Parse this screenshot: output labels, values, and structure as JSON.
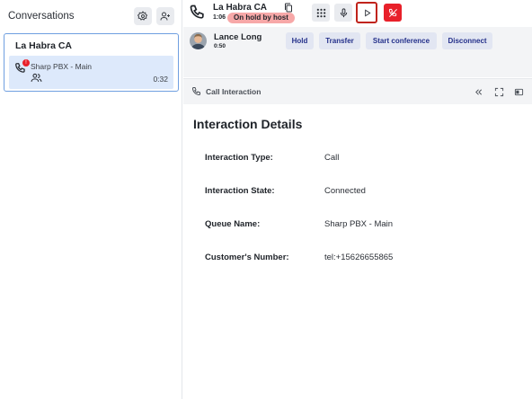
{
  "sidebar": {
    "title": "Conversations",
    "conversation": {
      "name": "La Habra CA",
      "queue": "Sharp PBX - Main",
      "duration": "0:32",
      "badge": "!"
    }
  },
  "callbar": {
    "name": "La Habra CA",
    "elapsed": "1:06",
    "status": "On hold by host"
  },
  "participant": {
    "name": "Lance Long",
    "duration": "0:50",
    "buttons": {
      "hold": "Hold",
      "transfer": "Transfer",
      "conference": "Start conference",
      "disconnect": "Disconnect"
    }
  },
  "interaction_panel": {
    "title": "Call Interaction"
  },
  "details": {
    "heading": "Interaction Details",
    "rows": [
      {
        "label": "Interaction Type:",
        "value": "Call"
      },
      {
        "label": "Interaction State:",
        "value": "Connected"
      },
      {
        "label": "Queue Name:",
        "value": "Sharp PBX - Main"
      },
      {
        "label": "Customer's Number:",
        "value": "tel:+15626655865"
      }
    ]
  },
  "colors": {
    "accent_blue": "#6f9fe0",
    "selected_item": "#dde9fb",
    "hold_badge": "#f7a8a8",
    "end_call": "#e8202a",
    "button_text": "#24308a",
    "highlight_border": "#c0231b"
  },
  "icons": [
    "settings-icon",
    "add-user-icon",
    "phone-icon",
    "people-icon",
    "copy-icon",
    "dialpad-icon",
    "microphone-icon",
    "play-icon",
    "end-call-icon",
    "collapse-icon",
    "expand-icon",
    "panel-icon"
  ]
}
